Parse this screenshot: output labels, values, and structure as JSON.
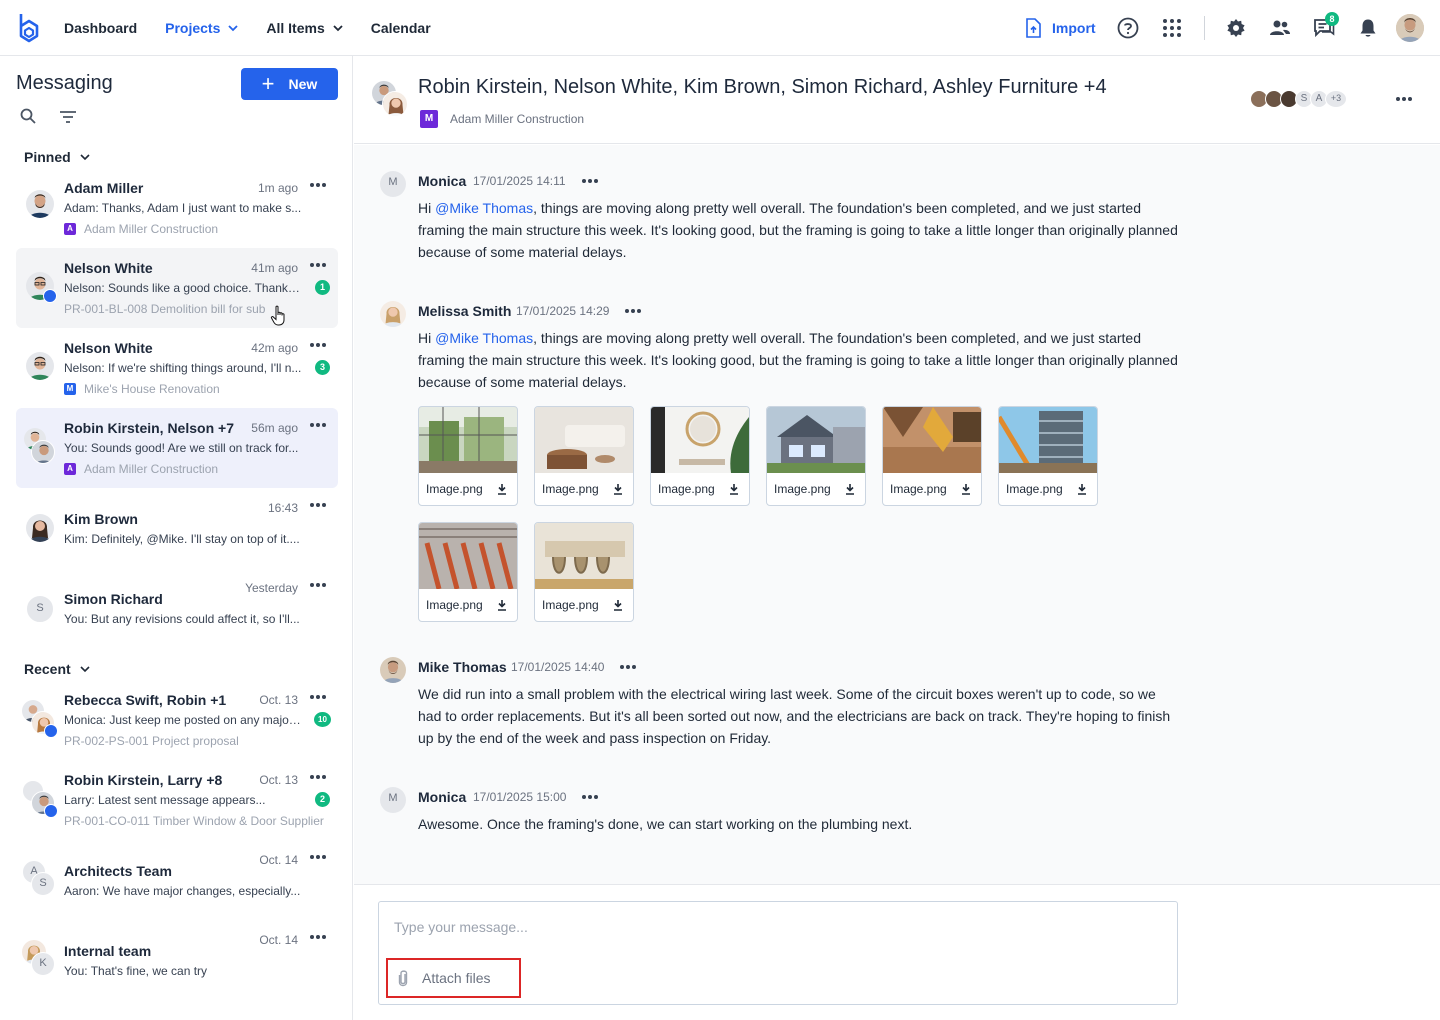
{
  "nav": {
    "items": [
      {
        "label": "Dashboard",
        "dropdown": false,
        "active": false
      },
      {
        "label": "Projects",
        "dropdown": true,
        "active": true
      },
      {
        "label": "All Items",
        "dropdown": true,
        "active": false
      },
      {
        "label": "Calendar",
        "dropdown": false,
        "active": false
      }
    ],
    "import_label": "Import",
    "messages_badge": "8"
  },
  "sidebar": {
    "title": "Messaging",
    "new_label": "New",
    "pinned_label": "Pinned",
    "recent_label": "Recent",
    "pinned": [
      {
        "name": "Adam Miller",
        "time": "1m ago",
        "preview": "Adam: Thanks, Adam I just want to make s...",
        "project": "Adam Miller Construction",
        "project_badge": "A",
        "unread": ""
      },
      {
        "name": "Nelson White",
        "time": "41m ago",
        "preview": "Nelson: Sounds like a good choice. Thanks...",
        "project": "PR-001-BL-008 Demolition bill for sub",
        "project_badge": "",
        "unread": "1"
      },
      {
        "name": "Nelson White",
        "time": "42m ago",
        "preview": "Nelson: If we're shifting things around, I'll n...",
        "project": "Mike's House Renovation",
        "project_badge": "M",
        "unread": "3"
      },
      {
        "name": "Robin Kirstein, Nelson  +7",
        "time": "56m ago",
        "preview": "You: Sounds good! Are we still on track for...",
        "project": "Adam Miller Construction",
        "project_badge": "A",
        "unread": ""
      },
      {
        "name": "Kim Brown",
        "time": "16:43",
        "preview": "Kim: Definitely, @Mike. I'll stay on top of it....",
        "project": "",
        "project_badge": "",
        "unread": ""
      },
      {
        "name": "Simon Richard",
        "time": "Yesterday",
        "preview": "You: But any revisions could affect it, so I'll...",
        "project": "",
        "project_badge": "",
        "unread": "",
        "avatar_letter": "S"
      }
    ],
    "recent": [
      {
        "name": "Rebecca Swift, Robin  +1",
        "time": "Oct. 13",
        "preview": "Monica: Just keep me posted on any major...",
        "project": "PR-002-PS-001 Project proposal",
        "unread": "10"
      },
      {
        "name": "Robin Kirstein, Larry  +8",
        "time": "Oct. 13",
        "preview": "Larry: Latest sent message appears...",
        "project": "PR-001-CO-011 Timber Window & Door Supplier",
        "unread": "2"
      },
      {
        "name": "Architects Team",
        "time": "Oct. 14",
        "preview": "Aaron: We have major changes, especially...",
        "project": "",
        "unread": "",
        "avatar_letters": [
          "A",
          "S"
        ]
      },
      {
        "name": "Internal team",
        "time": "Oct. 14",
        "preview": "You: That's fine, we can try",
        "project": "",
        "unread": "",
        "avatar_letters": [
          "",
          "K"
        ]
      }
    ]
  },
  "conversation": {
    "title": "Robin Kirstein, Nelson White, Kim Brown, Simon Richard, Ashley Furniture +4",
    "project_badge": "M",
    "project": "Adam Miller Construction",
    "member_letters": [
      "S",
      "A"
    ],
    "member_more": "+3"
  },
  "messages": [
    {
      "author": "Monica",
      "avatar_letter": "M",
      "time": "17/01/2025 14:11",
      "text_before": "Hi ",
      "mention": "@Mike Thomas",
      "text_after": ", things are moving along pretty well overall. The foundation's been completed, and we just started framing the main structure this week. It's looking good, but the framing is going to take a little longer than originally planned because of some material delays."
    },
    {
      "author": "Melissa Smith",
      "avatar_letter": "",
      "time": "17/01/2025 14:29",
      "text_before": "Hi ",
      "mention": "@Mike Thomas",
      "text_after": ", things are moving along pretty well overall. The foundation's been completed, and we just started framing the main structure this week. It's looking good, but the framing is going to take a little longer than originally planned because of some material delays.",
      "attachments": [
        "Image.png",
        "Image.png",
        "Image.png",
        "Image.png",
        "Image.png",
        "Image.png",
        "Image.png",
        "Image.png"
      ]
    },
    {
      "author": "Mike Thomas",
      "avatar_letter": "",
      "time": "17/01/2025 14:40",
      "text_before": "We did run into a small problem with the electrical wiring last week. Some of the circuit boxes weren't up to code, so we had to order replacements. But it's all been sorted out now, and the electricians are back on track. They're hoping to finish up by the end of the week and pass inspection on Friday.",
      "mention": "",
      "text_after": ""
    },
    {
      "author": "Monica",
      "avatar_letter": "M",
      "time": "17/01/2025 15:00",
      "text_before": "Awesome. Once the framing's done, we can start working on the plumbing next.",
      "mention": "",
      "text_after": ""
    }
  ],
  "composer": {
    "placeholder": "Type your message...",
    "attach_label": "Attach files"
  },
  "colors": {
    "accent": "#2563eb",
    "unread": "#10b981",
    "highlight_box": "#dc2626",
    "project_badge_purple": "#6d28d9"
  }
}
